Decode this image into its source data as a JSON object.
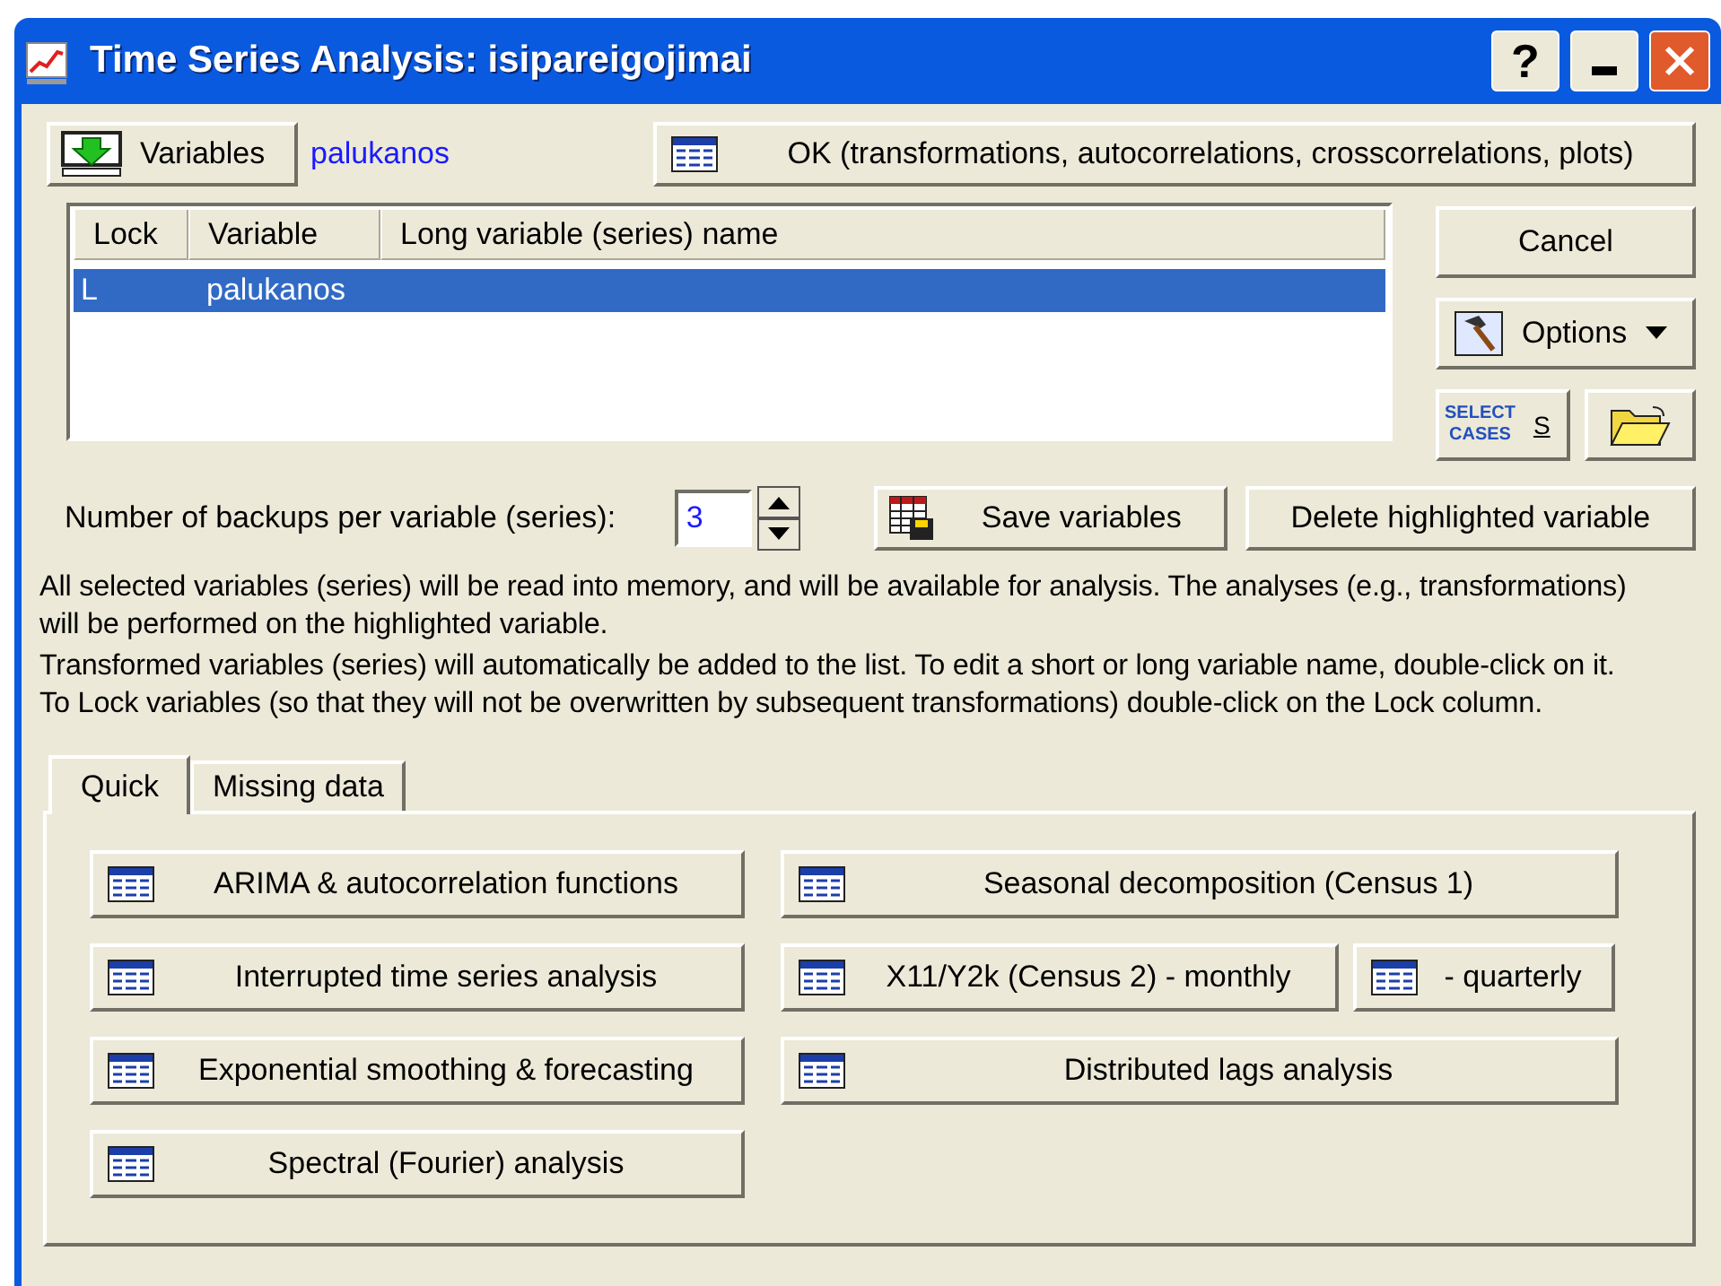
{
  "window": {
    "title": "Time Series Analysis: isipareigojimai",
    "help_label": "?"
  },
  "variables_button": {
    "label": "Variables"
  },
  "selected_variable": "palukanos",
  "ok_button": {
    "label": "OK (transformations, autocorrelations, crosscorrelations, plots)"
  },
  "variable_list": {
    "columns": [
      "Lock",
      "Variable",
      "Long variable (series) name"
    ],
    "rows": [
      {
        "lock": "L",
        "variable": "palukanos",
        "selected": true
      }
    ]
  },
  "cancel_button": {
    "label": "Cancel"
  },
  "options_button": {
    "label": "Options"
  },
  "select_cases_button": {
    "icon_lines": [
      "SELECT",
      "CASES"
    ],
    "label": "S"
  },
  "backups": {
    "label": "Number of backups per variable (series):",
    "value": "3"
  },
  "save_button": {
    "label": "Save variables"
  },
  "delete_button": {
    "label": "Delete highlighted variable"
  },
  "notes": [
    "All selected variables (series) will be read into memory, and will be available for analysis. The analyses (e.g., transformations)",
    "will be performed on the highlighted variable.",
    "Transformed variables (series) will automatically be added to the list. To edit a short or long variable name, double-click on it.",
    "To Lock variables (so that they will not be overwritten by subsequent transformations) double-click on the Lock column."
  ],
  "tabs": [
    {
      "label": "Quick",
      "selected": true
    },
    {
      "label": "Missing data",
      "selected": false
    }
  ],
  "analysis_rows": [
    [
      {
        "label": "ARIMA & autocorrelation functions"
      },
      {
        "label": "Seasonal decomposition (Census 1)"
      }
    ],
    [
      {
        "label": "Interrupted time series analysis"
      },
      {
        "label": "X11/Y2k (Census 2) - monthly"
      },
      {
        "label": "- quarterly"
      }
    ],
    [
      {
        "label": "Exponential smoothing & forecasting"
      },
      {
        "label": "Distributed lags analysis"
      }
    ],
    [
      {
        "label": "Spectral (Fourier) analysis"
      }
    ]
  ]
}
